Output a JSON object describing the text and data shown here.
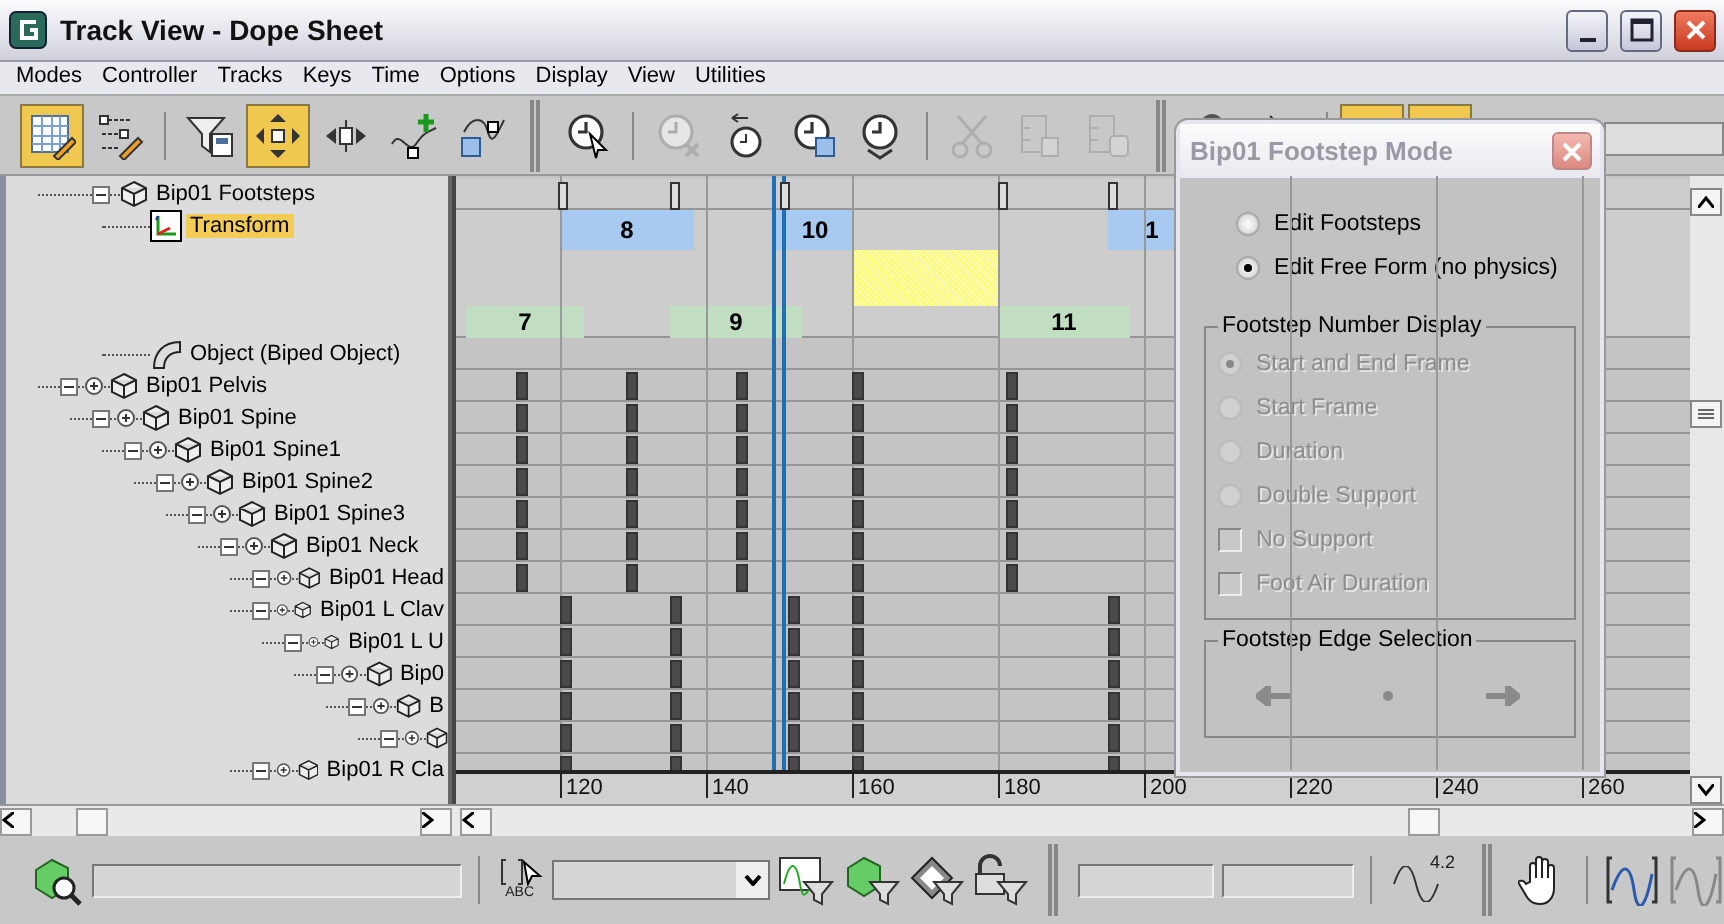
{
  "window": {
    "title": "Track View - Dope Sheet"
  },
  "menu": [
    "Modes",
    "Controller",
    "Tracks",
    "Keys",
    "Time",
    "Options",
    "Display",
    "View",
    "Utilities"
  ],
  "toolbar": [
    {
      "selected": true,
      "disabled": false
    },
    {
      "selected": false,
      "disabled": false
    },
    {
      "selected": false,
      "disabled": false
    },
    {
      "selected": true,
      "disabled": false
    },
    {
      "selected": false,
      "disabled": false
    },
    {
      "selected": false,
      "disabled": false
    },
    {
      "selected": false,
      "disabled": false
    },
    {
      "selected": false,
      "disabled": false
    },
    {
      "selected": false,
      "disabled": true
    },
    {
      "selected": false,
      "disabled": false
    },
    {
      "selected": false,
      "disabled": false
    },
    {
      "selected": false,
      "disabled": false
    },
    {
      "selected": false,
      "disabled": true
    },
    {
      "selected": false,
      "disabled": true
    },
    {
      "selected": false,
      "disabled": true
    },
    {
      "selected": false,
      "disabled": false
    },
    {
      "selected": false,
      "disabled": false
    },
    {
      "selected": true,
      "disabled": false
    },
    {
      "selected": true,
      "disabled": false
    }
  ],
  "tree": [
    {
      "kind": "footsteps",
      "label": "Bip01 Footsteps",
      "expanded": true,
      "selected": false,
      "children": [
        {
          "kind": "transform",
          "label": "Transform",
          "selected": true
        },
        {
          "kind": "object",
          "label": "Object (Biped Object)",
          "selected": false
        }
      ]
    },
    {
      "kind": "bone",
      "label": "Bip01 Pelvis",
      "expanded": true,
      "selected": false,
      "children": [
        {
          "kind": "bone",
          "label": "Bip01 Spine",
          "expanded": true,
          "selected": false,
          "children": [
            {
              "kind": "bone",
              "label": "Bip01 Spine1",
              "expanded": true,
              "selected": false,
              "children": [
                {
                  "kind": "bone",
                  "label": "Bip01 Spine2",
                  "expanded": true,
                  "selected": false,
                  "children": [
                    {
                      "kind": "bone",
                      "label": "Bip01 Spine3",
                      "expanded": true,
                      "selected": false,
                      "children": [
                        {
                          "kind": "bone",
                          "label": "Bip01 Neck",
                          "expanded": true,
                          "selected": false,
                          "children": [
                            {
                              "kind": "bone",
                              "label": "Bip01 Head",
                              "expanded": true,
                              "selected": false
                            },
                            {
                              "kind": "bone",
                              "label": "Bip01 L Clav",
                              "expanded": true,
                              "selected": false,
                              "children": [
                                {
                                  "kind": "bone",
                                  "label": "Bip01 L U",
                                  "expanded": true,
                                  "selected": false,
                                  "children": [
                                    {
                                      "kind": "bone",
                                      "label": "Bip0",
                                      "expanded": true,
                                      "selected": false,
                                      "children": [
                                        {
                                          "kind": "bone",
                                          "label": "B",
                                          "expanded": true,
                                          "selected": false,
                                          "children": [
                                            {
                                              "kind": "bone",
                                              "expanded": true
                                            }
                                          ]
                                        }
                                      ]
                                    }
                                  ]
                                }
                              ]
                            },
                            {
                              "kind": "bone",
                              "label": "Bip01 R Cla",
                              "expanded": true,
                              "selected": false
                            }
                          ]
                        }
                      ]
                    }
                  ]
                }
              ]
            }
          ]
        }
      ]
    }
  ],
  "footsteps": [
    {
      "label": "7",
      "color": "#c2dec2"
    },
    {
      "label": "8",
      "color": "#a8caf0"
    },
    {
      "label": "9",
      "color": "#c2dec2"
    },
    {
      "label": "10",
      "color": "#a8caf0"
    },
    {
      "label": "11",
      "color": "#c2dec2"
    },
    {
      "label": "1",
      "color": "#a8caf0"
    }
  ],
  "ruler": [
    "120",
    "140",
    "160",
    "180",
    "200",
    "220",
    "240",
    "260"
  ],
  "bottom_bar": {
    "rename_label": "ABC",
    "numeric_label": "4.2"
  },
  "dialog": {
    "title": "Bip01 Footstep Mode",
    "modes": [
      {
        "label": "Edit Footsteps",
        "selected": false
      },
      {
        "label": "Edit Free Form (no physics)",
        "selected": true
      }
    ],
    "number_display": {
      "title": "Footstep Number Display",
      "options": [
        {
          "kind": "radio",
          "label": "Start and End Frame",
          "selected": true,
          "disabled": true
        },
        {
          "kind": "radio",
          "label": "Start Frame",
          "selected": false,
          "disabled": true
        },
        {
          "kind": "radio",
          "label": "Duration",
          "selected": false,
          "disabled": true
        },
        {
          "kind": "radio",
          "label": "Double Support",
          "selected": false,
          "disabled": true
        },
        {
          "kind": "checkbox",
          "label": "No Support",
          "checked": false,
          "disabled": true
        },
        {
          "kind": "checkbox",
          "label": "Foot Air Duration",
          "checked": false,
          "disabled": true
        }
      ]
    },
    "edge_selection": {
      "title": "Footstep Edge Selection",
      "buttons": [
        {
          "disabled": true
        },
        {
          "disabled": true
        },
        {
          "disabled": true
        }
      ]
    }
  }
}
